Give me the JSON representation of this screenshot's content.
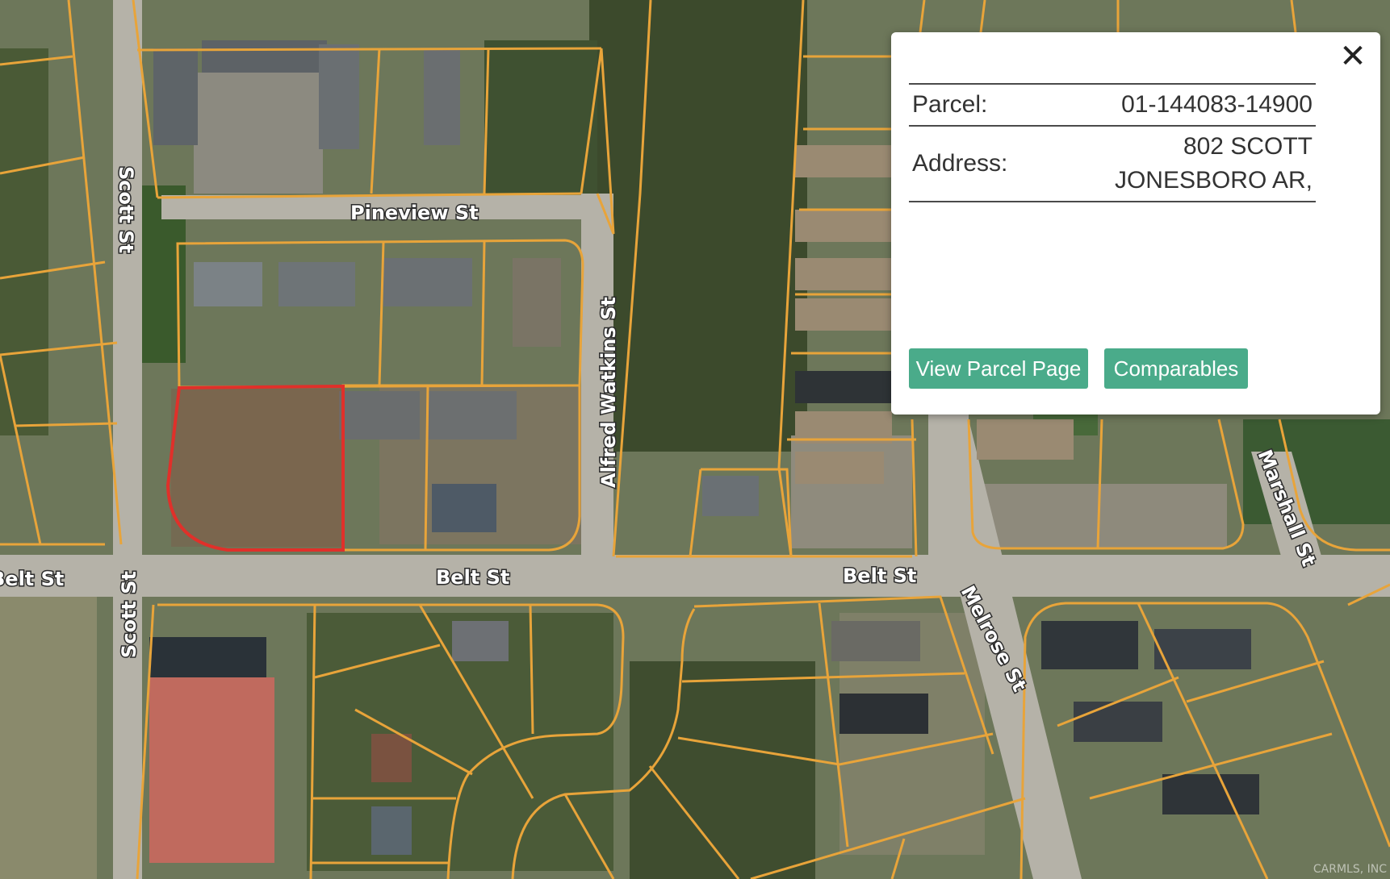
{
  "map": {
    "street_labels": {
      "pineview": "Pineview St",
      "scott_north": "Scott St",
      "scott_south": "Scott St",
      "alfred_watkins": "Alfred Watkins St",
      "belt_west": "Belt St",
      "belt_center": "Belt St",
      "belt_east": "Belt St",
      "melrose": "Melrose St",
      "marshall": "Marshall St"
    },
    "watermark": "CARMLS, INC",
    "colors": {
      "parcel_lines": "#e8a43a",
      "selected_parcel": "#e0302a",
      "road": "#b5b2a8"
    }
  },
  "popup": {
    "close_icon": "close-icon",
    "parcel_label": "Parcel:",
    "parcel_value": "01-144083-14900",
    "address_label": "Address:",
    "address_line1": "802 SCOTT",
    "address_line2": "JONESBORO AR,",
    "view_parcel_button": "View Parcel Page",
    "comparables_button": "Comparables",
    "button_color": "#4aab8a"
  }
}
